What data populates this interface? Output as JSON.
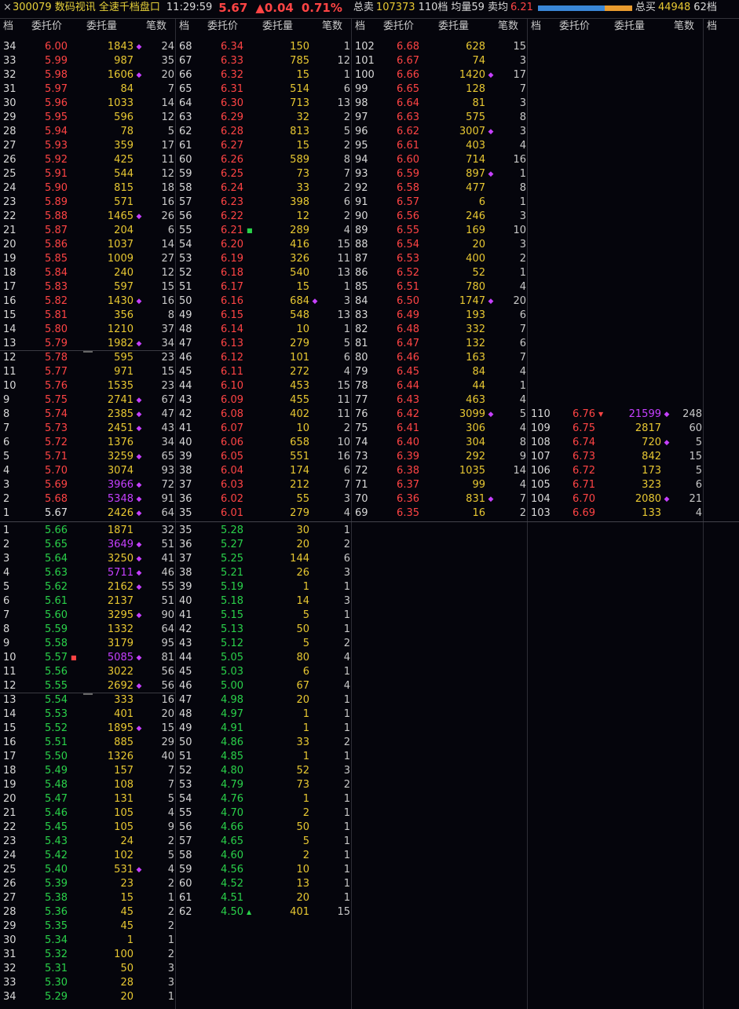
{
  "colors": {
    "up": "#ff4444",
    "down": "#2ad24a",
    "vol": "#e8c832",
    "big": "#c640ff",
    "flat": "#e0e0e0"
  },
  "header": {
    "close_icon": "close-icon",
    "code_name": "300079 数码视讯 全速千档盘口",
    "time": "11:29:59",
    "price": "5.67",
    "change": "▲0.04",
    "pct": "0.71%",
    "total_sell_label": "总卖",
    "total_sell": "107373",
    "sell_levels": "110档",
    "avg_vol_label": "均量",
    "avg_vol": "59",
    "sell_avg_label": "卖均",
    "sell_avg": "6.21",
    "sell_ratio": 0.71,
    "total_buy_label": "总买",
    "total_buy": "44948",
    "buy_levels": "62档"
  },
  "column_headers": {
    "level": "档",
    "price": "委托价",
    "volume": "委托量",
    "count": "笔数"
  },
  "asks": [
    [
      "34",
      "6.00",
      "1843",
      1,
      "24"
    ],
    [
      "33",
      "5.99",
      "987",
      0,
      "35"
    ],
    [
      "32",
      "5.98",
      "1606",
      1,
      "20"
    ],
    [
      "31",
      "5.97",
      "84",
      0,
      "7"
    ],
    [
      "30",
      "5.96",
      "1033",
      0,
      "14"
    ],
    [
      "29",
      "5.95",
      "596",
      0,
      "12"
    ],
    [
      "28",
      "5.94",
      "78",
      0,
      "5"
    ],
    [
      "27",
      "5.93",
      "359",
      0,
      "17"
    ],
    [
      "26",
      "5.92",
      "425",
      0,
      "11"
    ],
    [
      "25",
      "5.91",
      "544",
      0,
      "12"
    ],
    [
      "24",
      "5.90",
      "815",
      0,
      "18"
    ],
    [
      "23",
      "5.89",
      "571",
      0,
      "16"
    ],
    [
      "22",
      "5.88",
      "1465",
      1,
      "26"
    ],
    [
      "21",
      "5.87",
      "204",
      0,
      "6"
    ],
    [
      "20",
      "5.86",
      "1037",
      0,
      "14"
    ],
    [
      "19",
      "5.85",
      "1009",
      0,
      "27"
    ],
    [
      "18",
      "5.84",
      "240",
      0,
      "12"
    ],
    [
      "17",
      "5.83",
      "597",
      0,
      "15"
    ],
    [
      "16",
      "5.82",
      "1430",
      1,
      "16"
    ],
    [
      "15",
      "5.81",
      "356",
      0,
      "8"
    ],
    [
      "14",
      "5.80",
      "1210",
      0,
      "37"
    ],
    [
      "13",
      "5.79",
      "1982",
      1,
      "34"
    ],
    [
      "12",
      "5.78",
      "595",
      0,
      "23"
    ],
    [
      "11",
      "5.77",
      "971",
      0,
      "15"
    ],
    [
      "10",
      "5.76",
      "1535",
      0,
      "23"
    ],
    [
      "9",
      "5.75",
      "2741",
      1,
      "67"
    ],
    [
      "8",
      "5.74",
      "2385",
      1,
      "47"
    ],
    [
      "7",
      "5.73",
      "2451",
      1,
      "43"
    ],
    [
      "6",
      "5.72",
      "1376",
      0,
      "34"
    ],
    [
      "5",
      "5.71",
      "3259",
      1,
      "65"
    ],
    [
      "4",
      "5.70",
      "3074",
      0,
      "93"
    ],
    [
      "3",
      "5.69",
      "3966",
      2,
      "72"
    ],
    [
      "2",
      "5.68",
      "5348",
      2,
      "91"
    ],
    [
      "1",
      "5.67",
      "2426",
      1,
      "64"
    ],
    [
      "68",
      "6.34",
      "150",
      0,
      "1"
    ],
    [
      "67",
      "6.33",
      "785",
      0,
      "12"
    ],
    [
      "66",
      "6.32",
      "15",
      0,
      "1"
    ],
    [
      "65",
      "6.31",
      "514",
      0,
      "6"
    ],
    [
      "64",
      "6.30",
      "713",
      0,
      "13"
    ],
    [
      "63",
      "6.29",
      "32",
      0,
      "2"
    ],
    [
      "62",
      "6.28",
      "813",
      0,
      "5"
    ],
    [
      "61",
      "6.27",
      "15",
      0,
      "2"
    ],
    [
      "60",
      "6.26",
      "589",
      0,
      "8"
    ],
    [
      "59",
      "6.25",
      "73",
      0,
      "7"
    ],
    [
      "58",
      "6.24",
      "33",
      0,
      "2"
    ],
    [
      "57",
      "6.23",
      "398",
      0,
      "6"
    ],
    [
      "56",
      "6.22",
      "12",
      0,
      "2"
    ],
    [
      "55",
      "6.21",
      "289",
      0,
      "4"
    ],
    [
      "54",
      "6.20",
      "416",
      0,
      "15"
    ],
    [
      "53",
      "6.19",
      "326",
      0,
      "11"
    ],
    [
      "52",
      "6.18",
      "540",
      0,
      "13"
    ],
    [
      "51",
      "6.17",
      "15",
      0,
      "1"
    ],
    [
      "50",
      "6.16",
      "684",
      1,
      "3"
    ],
    [
      "49",
      "6.15",
      "548",
      0,
      "13"
    ],
    [
      "48",
      "6.14",
      "10",
      0,
      "1"
    ],
    [
      "47",
      "6.13",
      "279",
      0,
      "5"
    ],
    [
      "46",
      "6.12",
      "101",
      0,
      "6"
    ],
    [
      "45",
      "6.11",
      "272",
      0,
      "4"
    ],
    [
      "44",
      "6.10",
      "453",
      0,
      "15"
    ],
    [
      "43",
      "6.09",
      "455",
      0,
      "11"
    ],
    [
      "42",
      "6.08",
      "402",
      0,
      "11"
    ],
    [
      "41",
      "6.07",
      "10",
      0,
      "2"
    ],
    [
      "40",
      "6.06",
      "658",
      0,
      "10"
    ],
    [
      "39",
      "6.05",
      "551",
      0,
      "16"
    ],
    [
      "38",
      "6.04",
      "174",
      0,
      "6"
    ],
    [
      "37",
      "6.03",
      "212",
      0,
      "7"
    ],
    [
      "36",
      "6.02",
      "55",
      0,
      "3"
    ],
    [
      "35",
      "6.01",
      "279",
      0,
      "4"
    ],
    [
      "102",
      "6.68",
      "628",
      0,
      "15"
    ],
    [
      "101",
      "6.67",
      "74",
      0,
      "3"
    ],
    [
      "100",
      "6.66",
      "1420",
      1,
      "17"
    ],
    [
      "99",
      "6.65",
      "128",
      0,
      "7"
    ],
    [
      "98",
      "6.64",
      "81",
      0,
      "3"
    ],
    [
      "97",
      "6.63",
      "575",
      0,
      "8"
    ],
    [
      "96",
      "6.62",
      "3007",
      1,
      "3"
    ],
    [
      "95",
      "6.61",
      "403",
      0,
      "4"
    ],
    [
      "94",
      "6.60",
      "714",
      0,
      "16"
    ],
    [
      "93",
      "6.59",
      "897",
      1,
      "1"
    ],
    [
      "92",
      "6.58",
      "477",
      0,
      "8"
    ],
    [
      "91",
      "6.57",
      "6",
      0,
      "1"
    ],
    [
      "90",
      "6.56",
      "246",
      0,
      "3"
    ],
    [
      "89",
      "6.55",
      "169",
      0,
      "10"
    ],
    [
      "88",
      "6.54",
      "20",
      0,
      "3"
    ],
    [
      "87",
      "6.53",
      "400",
      0,
      "2"
    ],
    [
      "86",
      "6.52",
      "52",
      0,
      "1"
    ],
    [
      "85",
      "6.51",
      "780",
      0,
      "4"
    ],
    [
      "84",
      "6.50",
      "1747",
      1,
      "20"
    ],
    [
      "83",
      "6.49",
      "193",
      0,
      "6"
    ],
    [
      "82",
      "6.48",
      "332",
      0,
      "7"
    ],
    [
      "81",
      "6.47",
      "132",
      0,
      "6"
    ],
    [
      "80",
      "6.46",
      "163",
      0,
      "7"
    ],
    [
      "79",
      "6.45",
      "84",
      0,
      "4"
    ],
    [
      "78",
      "6.44",
      "44",
      0,
      "1"
    ],
    [
      "77",
      "6.43",
      "463",
      0,
      "4"
    ],
    [
      "76",
      "6.42",
      "3099",
      1,
      "5"
    ],
    [
      "75",
      "6.41",
      "306",
      0,
      "4"
    ],
    [
      "74",
      "6.40",
      "304",
      0,
      "8"
    ],
    [
      "73",
      "6.39",
      "292",
      0,
      "9"
    ],
    [
      "72",
      "6.38",
      "1035",
      0,
      "14"
    ],
    [
      "71",
      "6.37",
      "99",
      0,
      "4"
    ],
    [
      "70",
      "6.36",
      "831",
      1,
      "7"
    ],
    [
      "69",
      "6.35",
      "16",
      0,
      "2"
    ],
    [
      "110",
      "6.76",
      "21599",
      3,
      "248"
    ],
    [
      "109",
      "6.75",
      "2817",
      0,
      "60"
    ],
    [
      "108",
      "6.74",
      "720",
      1,
      "5"
    ],
    [
      "107",
      "6.73",
      "842",
      0,
      "15"
    ],
    [
      "106",
      "6.72",
      "173",
      0,
      "5"
    ],
    [
      "105",
      "6.71",
      "323",
      0,
      "6"
    ],
    [
      "104",
      "6.70",
      "2080",
      1,
      "21"
    ],
    [
      "103",
      "6.69",
      "133",
      0,
      "4"
    ]
  ],
  "bids": [
    [
      "1",
      "5.66",
      "1871",
      0,
      "32"
    ],
    [
      "2",
      "5.65",
      "3649",
      2,
      "51"
    ],
    [
      "3",
      "5.64",
      "3250",
      1,
      "41"
    ],
    [
      "4",
      "5.63",
      "5711",
      2,
      "46"
    ],
    [
      "5",
      "5.62",
      "2162",
      1,
      "55"
    ],
    [
      "6",
      "5.61",
      "2137",
      0,
      "51"
    ],
    [
      "7",
      "5.60",
      "3295",
      1,
      "90"
    ],
    [
      "8",
      "5.59",
      "1332",
      0,
      "64"
    ],
    [
      "9",
      "5.58",
      "3179",
      0,
      "95"
    ],
    [
      "10",
      "5.57",
      "5085",
      2,
      "81"
    ],
    [
      "11",
      "5.56",
      "3022",
      0,
      "56"
    ],
    [
      "12",
      "5.55",
      "2692",
      1,
      "56"
    ],
    [
      "13",
      "5.54",
      "333",
      0,
      "16"
    ],
    [
      "14",
      "5.53",
      "401",
      0,
      "20"
    ],
    [
      "15",
      "5.52",
      "1895",
      1,
      "15"
    ],
    [
      "16",
      "5.51",
      "885",
      0,
      "29"
    ],
    [
      "17",
      "5.50",
      "1326",
      0,
      "40"
    ],
    [
      "18",
      "5.49",
      "157",
      0,
      "7"
    ],
    [
      "19",
      "5.48",
      "108",
      0,
      "7"
    ],
    [
      "20",
      "5.47",
      "131",
      0,
      "5"
    ],
    [
      "21",
      "5.46",
      "105",
      0,
      "4"
    ],
    [
      "22",
      "5.45",
      "105",
      0,
      "9"
    ],
    [
      "23",
      "5.43",
      "24",
      0,
      "2"
    ],
    [
      "24",
      "5.42",
      "102",
      0,
      "5"
    ],
    [
      "25",
      "5.40",
      "531",
      1,
      "4"
    ],
    [
      "26",
      "5.39",
      "23",
      0,
      "2"
    ],
    [
      "27",
      "5.38",
      "15",
      0,
      "1"
    ],
    [
      "28",
      "5.36",
      "45",
      0,
      "2"
    ],
    [
      "29",
      "5.35",
      "45",
      0,
      "2"
    ],
    [
      "30",
      "5.34",
      "1",
      0,
      "1"
    ],
    [
      "31",
      "5.32",
      "100",
      0,
      "2"
    ],
    [
      "32",
      "5.31",
      "50",
      0,
      "3"
    ],
    [
      "33",
      "5.30",
      "28",
      0,
      "3"
    ],
    [
      "34",
      "5.29",
      "20",
      0,
      "1"
    ],
    [
      "35",
      "5.28",
      "30",
      0,
      "1"
    ],
    [
      "36",
      "5.27",
      "20",
      0,
      "2"
    ],
    [
      "37",
      "5.25",
      "144",
      0,
      "6"
    ],
    [
      "38",
      "5.21",
      "26",
      0,
      "3"
    ],
    [
      "39",
      "5.19",
      "1",
      0,
      "1"
    ],
    [
      "40",
      "5.18",
      "14",
      0,
      "3"
    ],
    [
      "41",
      "5.15",
      "5",
      0,
      "1"
    ],
    [
      "42",
      "5.13",
      "50",
      0,
      "1"
    ],
    [
      "43",
      "5.12",
      "5",
      0,
      "2"
    ],
    [
      "44",
      "5.05",
      "80",
      0,
      "4"
    ],
    [
      "45",
      "5.03",
      "6",
      0,
      "1"
    ],
    [
      "46",
      "5.00",
      "67",
      0,
      "4"
    ],
    [
      "47",
      "4.98",
      "20",
      0,
      "1"
    ],
    [
      "48",
      "4.97",
      "1",
      0,
      "1"
    ],
    [
      "49",
      "4.91",
      "1",
      0,
      "1"
    ],
    [
      "50",
      "4.86",
      "33",
      0,
      "2"
    ],
    [
      "51",
      "4.85",
      "1",
      0,
      "1"
    ],
    [
      "52",
      "4.80",
      "52",
      0,
      "3"
    ],
    [
      "53",
      "4.79",
      "73",
      0,
      "2"
    ],
    [
      "54",
      "4.76",
      "1",
      0,
      "1"
    ],
    [
      "55",
      "4.70",
      "2",
      0,
      "1"
    ],
    [
      "56",
      "4.66",
      "50",
      0,
      "1"
    ],
    [
      "57",
      "4.65",
      "5",
      0,
      "1"
    ],
    [
      "58",
      "4.60",
      "2",
      0,
      "1"
    ],
    [
      "59",
      "4.56",
      "10",
      0,
      "1"
    ],
    [
      "60",
      "4.52",
      "13",
      0,
      "1"
    ],
    [
      "61",
      "4.51",
      "20",
      0,
      "1"
    ],
    [
      "62",
      "4.50",
      "401",
      0,
      "15"
    ]
  ],
  "markers": {
    "sell_avg_level": "55",
    "sell_top": "110",
    "buy_low": "62",
    "bid_ten": "10"
  }
}
